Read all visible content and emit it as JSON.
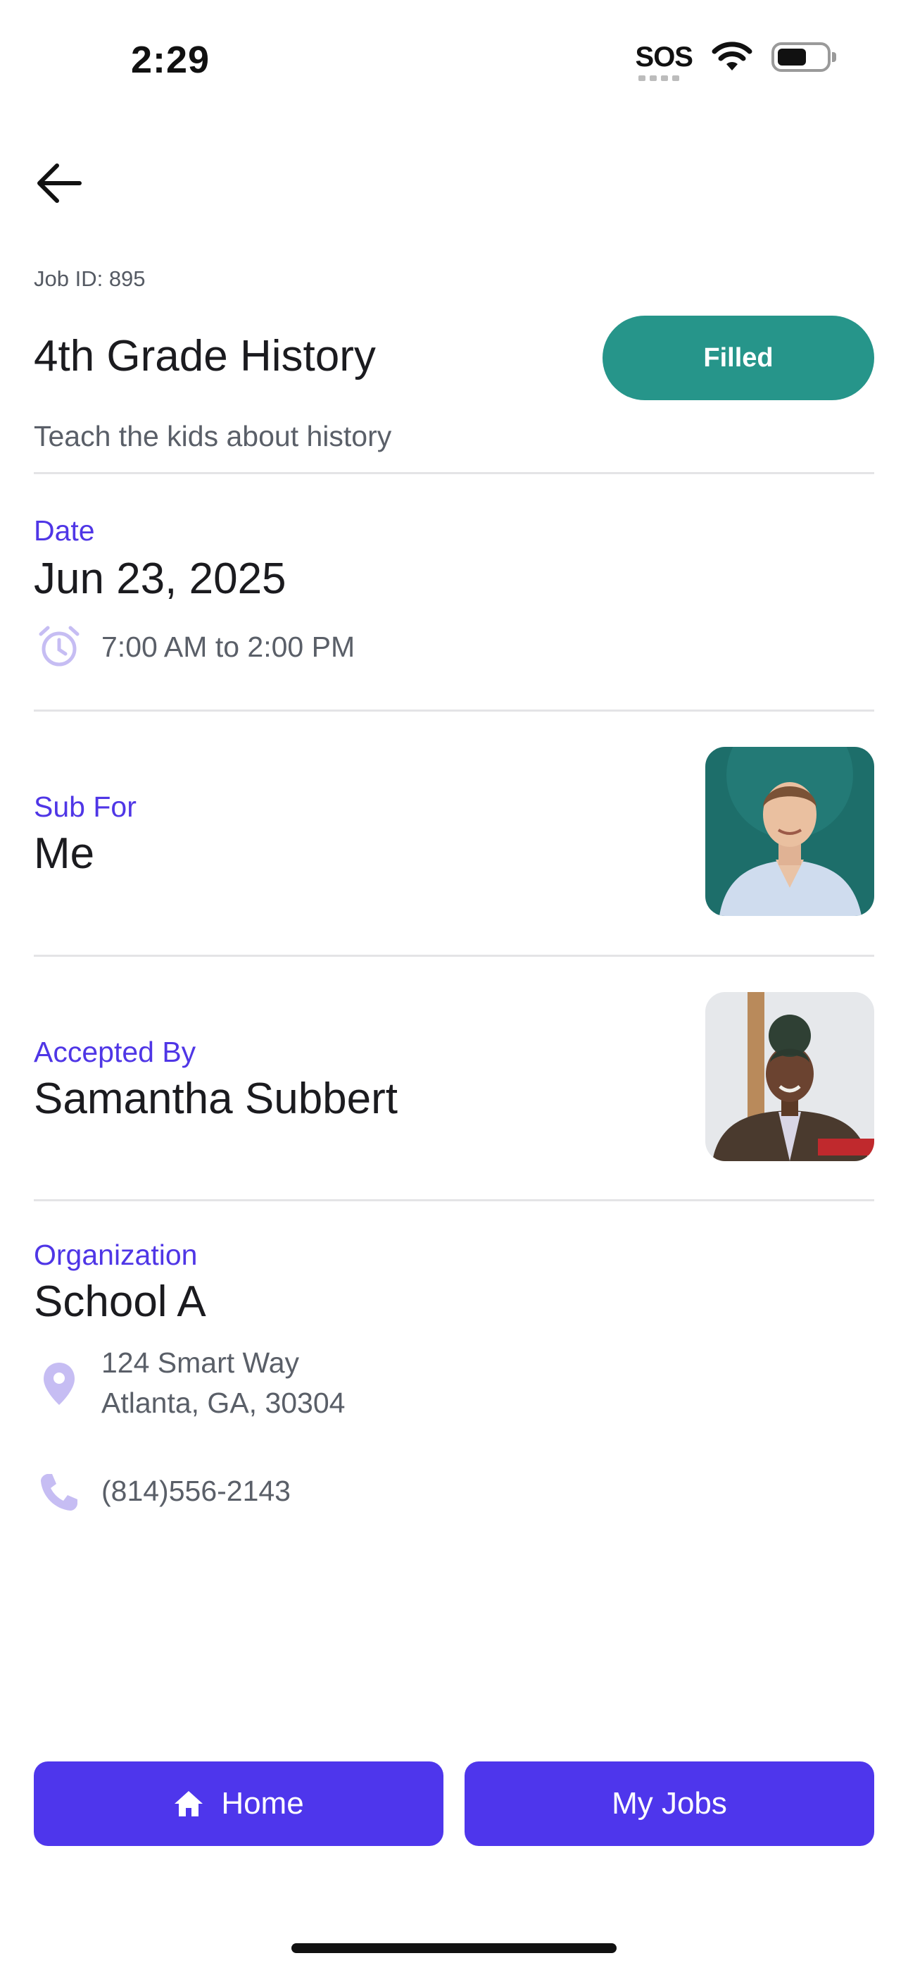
{
  "status_bar": {
    "time": "2:29",
    "sos": "SOS"
  },
  "job": {
    "id_label": "Job ID: 895",
    "title": "4th Grade History",
    "status": "Filled",
    "description": "Teach the kids about history"
  },
  "date_section": {
    "label": "Date",
    "date": "Jun 23, 2025",
    "time_range": "7:00 AM to 2:00 PM"
  },
  "sub_for": {
    "label": "Sub For",
    "name": "Me"
  },
  "accepted_by": {
    "label": "Accepted By",
    "name": "Samantha Subbert"
  },
  "organization": {
    "label": "Organization",
    "name": "School A",
    "address_line1": "124 Smart Way",
    "address_line2": "Atlanta, GA, 30304",
    "phone": "(814)556-2143"
  },
  "buttons": {
    "home": "Home",
    "my_jobs": "My Jobs"
  },
  "colors": {
    "accent": "#4e36ec",
    "status_filled": "#26958a",
    "label": "#4f36e6",
    "icon_muted": "#c6bdf3"
  },
  "icons": [
    "back-arrow-icon",
    "alarm-clock-icon",
    "location-pin-icon",
    "phone-icon",
    "home-icon",
    "wifi-icon",
    "battery-icon"
  ]
}
